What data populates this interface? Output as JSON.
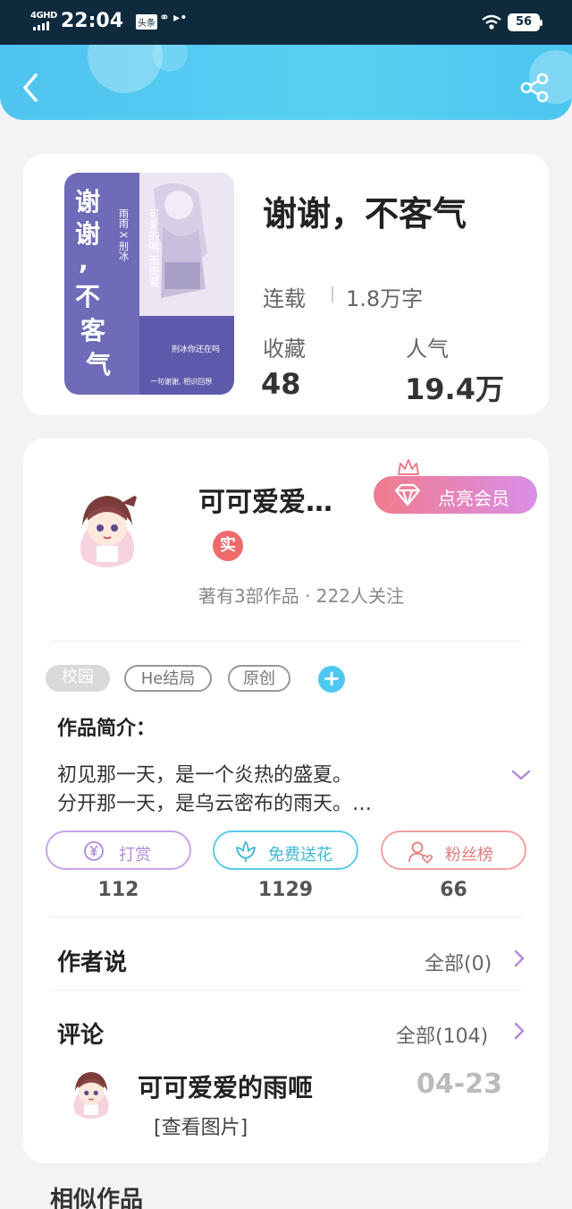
{
  "status_bar": {
    "network": "4GHD",
    "time": "22:04",
    "app_badge": "头条",
    "dots": "⚭ ▸•",
    "battery": "56"
  },
  "header": {
    "back_icon": "chevron-left-icon",
    "share_icon": "share-icon"
  },
  "book": {
    "title": "谢谢，不客气",
    "status": "连载",
    "words": "1.8万字",
    "favorites_label": "收藏",
    "favorites": "48",
    "popularity_label": "人气",
    "popularity": "19.4万",
    "cover": {
      "title_text": "谢谢，不客气",
      "author_text": "雨雨 X 刑冰",
      "side_text": "可爱的哨 雨雨著",
      "tagline": "刑冰你还在吗",
      "footer": "一句谢谢, 相识回想"
    }
  },
  "author": {
    "name": "可可爱爱…",
    "vip_button": "点亮会员",
    "real_badge": "实",
    "stats": "著有3部作品 · 222人关注"
  },
  "tags": [
    "校园",
    "He结局",
    "原创"
  ],
  "intro": {
    "label": "作品简介：",
    "lines": [
      "初见那一天，是一个炎热的盛夏。",
      "分开那一天，是乌云密布的雨天。…"
    ]
  },
  "actions": [
    {
      "label": "打赏",
      "count": "112",
      "icon": "yuan-coin-icon"
    },
    {
      "label": "免费送花",
      "count": "1129",
      "icon": "flower-icon"
    },
    {
      "label": "粉丝榜",
      "count": "66",
      "icon": "fan-user-icon"
    }
  ],
  "author_says": {
    "title": "作者说",
    "more": "全部(0)"
  },
  "comments": {
    "title": "评论",
    "more": "全部(104)",
    "items": [
      {
        "user": "可可爱爱的雨咂",
        "date": "04-23",
        "text": "[查看图片]"
      }
    ]
  },
  "similar": {
    "title": "相似作品"
  },
  "colors": {
    "header": "#4fc4f0",
    "accent_pink": "#f07b8c",
    "accent_cyan": "#4ec8f0",
    "accent_purple": "#c7a3e8"
  }
}
